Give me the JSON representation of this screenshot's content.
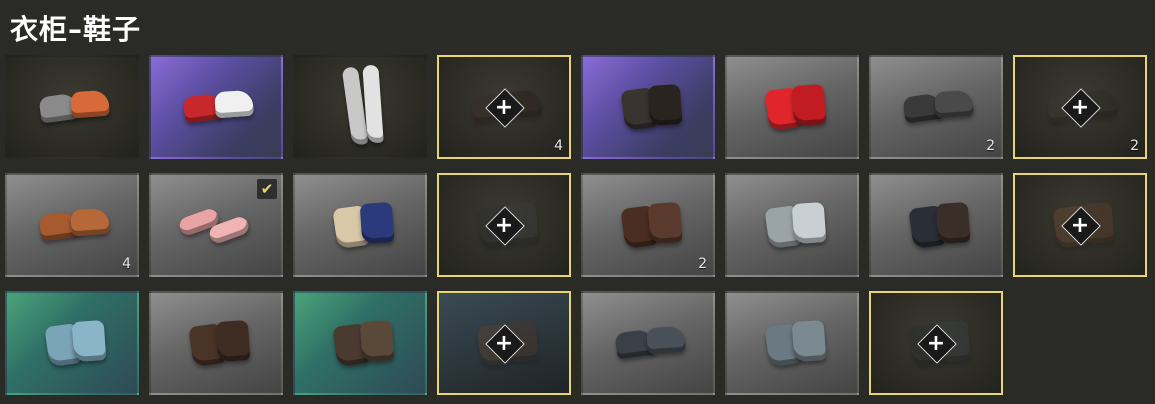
{
  "title": "衣柜–鞋子",
  "items": [
    {
      "bg": "bg-dark",
      "shoe": "sneaker",
      "c1": "#8a8a8a",
      "c2": "#d86a3a",
      "highlight": false,
      "equipped": false,
      "count": ""
    },
    {
      "bg": "bg-purple",
      "shoe": "sneaker",
      "c1": "#c8282c",
      "c2": "#f0f0f0",
      "highlight": false,
      "equipped": false,
      "count": ""
    },
    {
      "bg": "bg-dark",
      "shoe": "tall",
      "c1": "#c8c8c8",
      "c2": "#e2e2e2",
      "highlight": false,
      "equipped": false,
      "count": ""
    },
    {
      "bg": "bg-dark",
      "shoe": "sneaker",
      "c1": "#3b2c24",
      "c2": "#2a201a",
      "highlight": true,
      "equipped": false,
      "count": "4"
    },
    {
      "bg": "bg-purple",
      "shoe": "boot",
      "c1": "#3a3430",
      "c2": "#2a2420",
      "highlight": false,
      "equipped": false,
      "count": ""
    },
    {
      "bg": "bg-gray",
      "shoe": "boot",
      "c1": "#e0262c",
      "c2": "#c01c22",
      "highlight": false,
      "equipped": false,
      "count": ""
    },
    {
      "bg": "bg-gray",
      "shoe": "sneaker",
      "c1": "#3a3a3a",
      "c2": "#4a4a4a",
      "highlight": false,
      "equipped": false,
      "count": "2"
    },
    {
      "bg": "bg-dark",
      "shoe": "sneaker",
      "c1": "#3a3a32",
      "c2": "#2c2c26",
      "highlight": true,
      "equipped": false,
      "count": "2"
    },
    {
      "bg": "bg-gray",
      "shoe": "sneaker",
      "c1": "#a65a2e",
      "c2": "#b66838",
      "highlight": false,
      "equipped": false,
      "count": "4"
    },
    {
      "bg": "bg-gray",
      "shoe": "slide",
      "c1": "#e8a4a4",
      "c2": "#f0b4b4",
      "highlight": false,
      "equipped": true,
      "count": ""
    },
    {
      "bg": "bg-gray",
      "shoe": "boot",
      "c1": "#d8c8a8",
      "c2": "#2a3a7a",
      "highlight": false,
      "equipped": false,
      "count": ""
    },
    {
      "bg": "bg-dark",
      "shoe": "boot",
      "c1": "#2e2e2e",
      "c2": "#3a3a3a",
      "highlight": true,
      "equipped": false,
      "count": ""
    },
    {
      "bg": "bg-gray",
      "shoe": "boot",
      "c1": "#4a2e24",
      "c2": "#5a3a2c",
      "highlight": false,
      "equipped": false,
      "count": "2"
    },
    {
      "bg": "bg-gray",
      "shoe": "boot",
      "c1": "#9aa4a8",
      "c2": "#c8d0d4",
      "highlight": false,
      "equipped": false,
      "count": ""
    },
    {
      "bg": "bg-gray",
      "shoe": "boot",
      "c1": "#2a2e36",
      "c2": "#3a2e28",
      "highlight": false,
      "equipped": false,
      "count": ""
    },
    {
      "bg": "bg-dark",
      "shoe": "boot",
      "c1": "#6a4a32",
      "c2": "#5a3c28",
      "highlight": true,
      "equipped": false,
      "count": ""
    },
    {
      "bg": "bg-green",
      "shoe": "boot",
      "c1": "#7aa4b8",
      "c2": "#8ab4c8",
      "highlight": false,
      "equipped": false,
      "count": ""
    },
    {
      "bg": "bg-gray",
      "shoe": "boot",
      "c1": "#4a3428",
      "c2": "#3e2c22",
      "highlight": false,
      "equipped": false,
      "count": ""
    },
    {
      "bg": "bg-green",
      "shoe": "boot",
      "c1": "#4a3a30",
      "c2": "#5a4838",
      "highlight": false,
      "equipped": false,
      "count": ""
    },
    {
      "bg": "bg-teal",
      "shoe": "boot",
      "c1": "#5a4230",
      "c2": "#4a3628",
      "highlight": true,
      "equipped": false,
      "count": ""
    },
    {
      "bg": "bg-gray",
      "shoe": "sneaker",
      "c1": "#3a4048",
      "c2": "#4a5058",
      "highlight": false,
      "equipped": false,
      "count": ""
    },
    {
      "bg": "bg-gray",
      "shoe": "boot",
      "c1": "#6a7a80",
      "c2": "#7a8a90",
      "highlight": false,
      "equipped": false,
      "count": ""
    },
    {
      "bg": "bg-dark",
      "shoe": "boot",
      "c1": "#2a2e32",
      "c2": "#3a3e42",
      "highlight": true,
      "equipped": false,
      "count": ""
    }
  ],
  "plus_symbol": "+",
  "check_symbol": "✔"
}
